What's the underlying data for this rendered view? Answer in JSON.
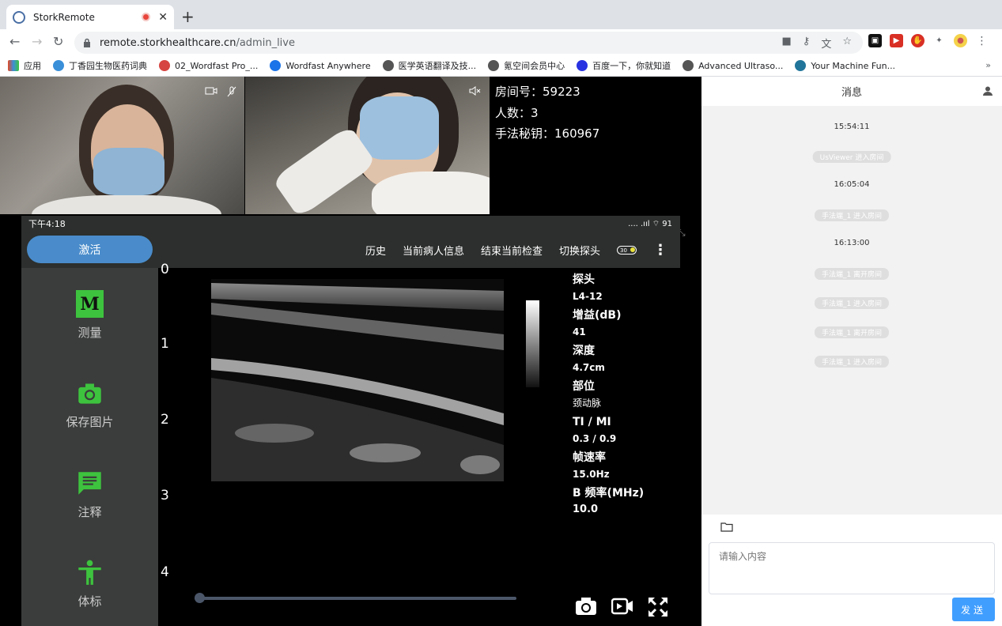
{
  "browser": {
    "tab_title": "StorkRemote",
    "url_host": "remote.storkhealthcare.cn",
    "url_path": "/admin_live",
    "bookmarks": [
      {
        "label": "应用",
        "color": "#e34c26"
      },
      {
        "label": "丁香园生物医药词典",
        "color": "#3a8fd9"
      },
      {
        "label": "02_Wordfast Pro_...",
        "color": "#d64541"
      },
      {
        "label": "Wordfast Anywhere",
        "color": "#1a73e8"
      },
      {
        "label": "医学英语翻译及技...",
        "color": "#555555"
      },
      {
        "label": "氪空间会员中心",
        "color": "#555555"
      },
      {
        "label": "百度一下，你就知道",
        "color": "#2932e1"
      },
      {
        "label": "Advanced Ultraso...",
        "color": "#555555"
      },
      {
        "label": "Your Machine Fun...",
        "color": "#21759b"
      }
    ],
    "bookmarks_more": "»"
  },
  "room": {
    "room_no": "房间号：59223",
    "people": "人数：3",
    "key": "手法秘钥：160967"
  },
  "phone": {
    "status_time": "下午4:18",
    "status_right": ".... .ııl ⌔ 91",
    "activate": "激活",
    "toolbar_items": [
      "历史",
      "当前病人信息",
      "结束当前检查",
      "切换探头"
    ],
    "toggle_label": "30",
    "sidebar": [
      {
        "label": "测量",
        "icon": "M"
      },
      {
        "label": "保存图片",
        "icon": "camera"
      },
      {
        "label": "注释",
        "icon": "comment"
      },
      {
        "label": "体标",
        "icon": "body"
      }
    ],
    "depth_ticks": [
      "0",
      "1",
      "2",
      "3",
      "4"
    ],
    "params": [
      {
        "label": "探头",
        "value": "L4-12"
      },
      {
        "label": "增益(dB)",
        "value": "41"
      },
      {
        "label": "深度",
        "value": "4.7cm"
      },
      {
        "label": "部位",
        "value": "颈动脉"
      },
      {
        "label": "TI / MI",
        "value": "0.3 / 0.9"
      },
      {
        "label": "帧速率",
        "value": "15.0Hz"
      },
      {
        "label": "B 频率(MHz)",
        "value": "10.0"
      }
    ]
  },
  "chat": {
    "title": "消息",
    "messages": [
      {
        "type": "time",
        "text": "15:54:11"
      },
      {
        "type": "event",
        "text": "UsViewer 进入房间"
      },
      {
        "type": "time",
        "text": "16:05:04"
      },
      {
        "type": "event",
        "text": "手法端_1 进入房间"
      },
      {
        "type": "time",
        "text": "16:13:00"
      },
      {
        "type": "event",
        "text": "手法端_1 离开房间"
      },
      {
        "type": "event",
        "text": "手法端_1 进入房间"
      },
      {
        "type": "event",
        "text": "手法端_1 离开房间"
      },
      {
        "type": "event",
        "text": "手法端_1 进入房间"
      }
    ],
    "input_placeholder": "请输入内容",
    "send_label": "发送"
  }
}
